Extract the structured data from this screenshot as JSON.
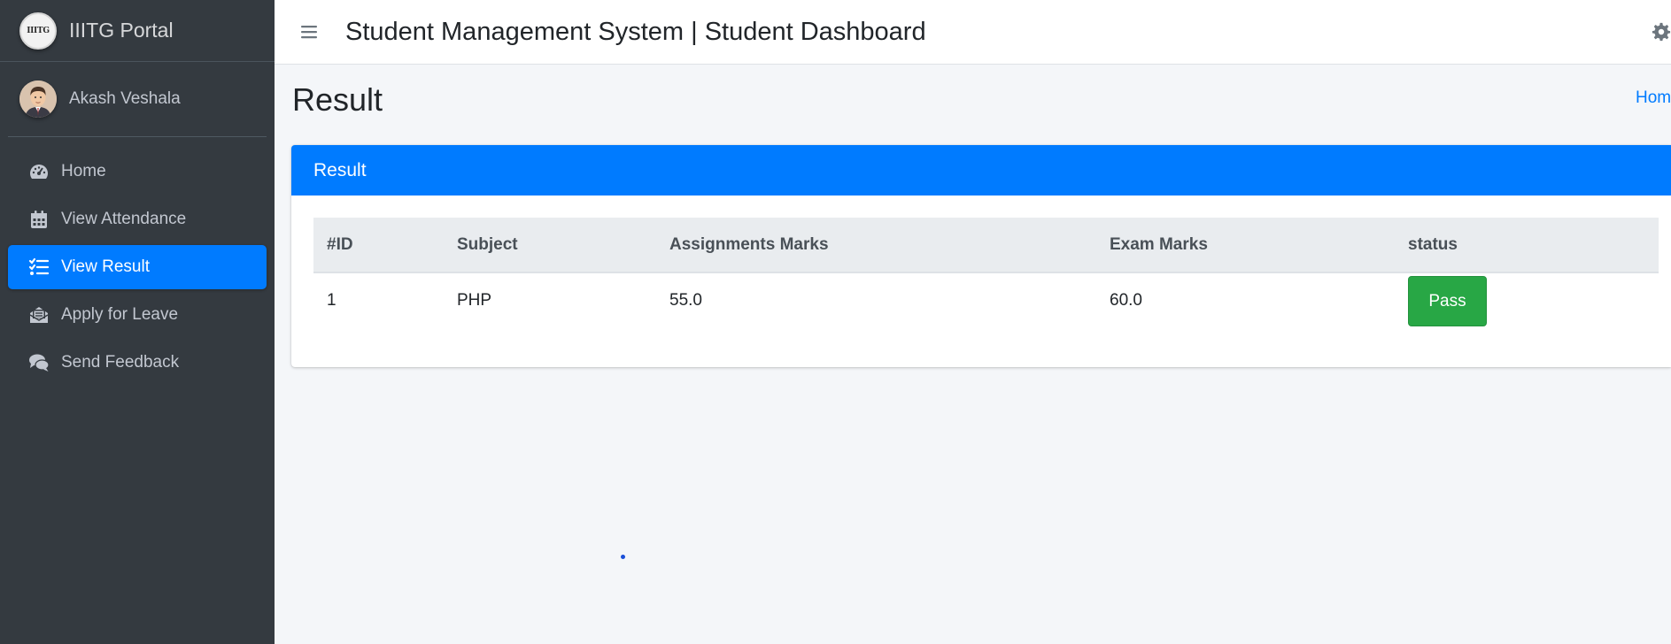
{
  "brand": {
    "title": "IIITG Portal",
    "logo_text": "IIITG"
  },
  "user": {
    "name": "Akash Veshala"
  },
  "nav": [
    {
      "label": "Home",
      "icon": "tachometer-icon",
      "active": false
    },
    {
      "label": "View Attendance",
      "icon": "calendar-icon",
      "active": false
    },
    {
      "label": "View Result",
      "icon": "tasks-list-icon",
      "active": true
    },
    {
      "label": "Apply for Leave",
      "icon": "envelope-open-icon",
      "active": false
    },
    {
      "label": "Send Feedback",
      "icon": "comments-icon",
      "active": false
    }
  ],
  "header": {
    "title": "Student Management System | Student Dashboard",
    "menu_icon": "hamburger-icon",
    "settings_icon": "gear-icon"
  },
  "page": {
    "title": "Result",
    "breadcrumb": "Home"
  },
  "card": {
    "title": "Result",
    "columns": [
      "#ID",
      "Subject",
      "Assignments Marks",
      "Exam Marks",
      "status"
    ],
    "rows": [
      {
        "id": "1",
        "subject": "PHP",
        "assignments": "55.0",
        "exam": "60.0",
        "status": "Pass"
      }
    ]
  },
  "colors": {
    "sidebar": "#343a40",
    "primary": "#007bff",
    "success": "#28a745",
    "background": "#f4f6f9"
  }
}
